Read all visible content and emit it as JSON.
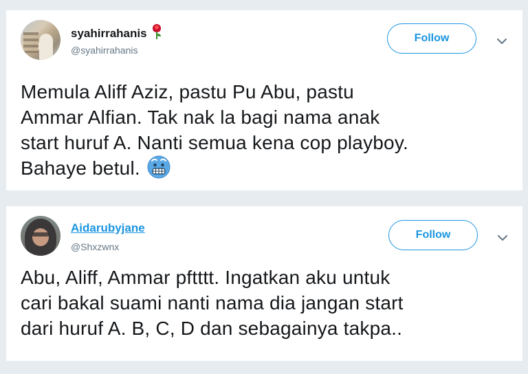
{
  "tweets": [
    {
      "display_name": "syahirrahanis",
      "name_emoji_icon": "rose-icon",
      "handle": "@syahirrahanis",
      "follow_label": "Follow",
      "menu_icon": "chevron-down-icon",
      "text_lines": [
        "Memula Aliff Aziz, pastu Pu Abu, pastu",
        "Ammar Alfian. Tak nak la bagi nama anak",
        "start huruf A. Nanti semua kena cop playboy.",
        "Bahaye betul."
      ],
      "text_emoji_icon": "cold-face-icon"
    },
    {
      "display_name": "Aidarubyjane",
      "handle": "@Shxzwnx",
      "follow_label": "Follow",
      "menu_icon": "chevron-down-icon",
      "text_lines": [
        "Abu, Aliff, Ammar pftttt. Ingatkan aku untuk",
        "cari bakal suami nanti nama dia jangan start",
        "dari huruf A. B, C, D dan sebagainya takpa.."
      ]
    }
  ],
  "colors": {
    "page_background": "#e6ecf0",
    "card_background": "#ffffff",
    "accent_blue": "#1b95e0",
    "text_primary": "#14171a",
    "text_secondary": "#657786"
  }
}
